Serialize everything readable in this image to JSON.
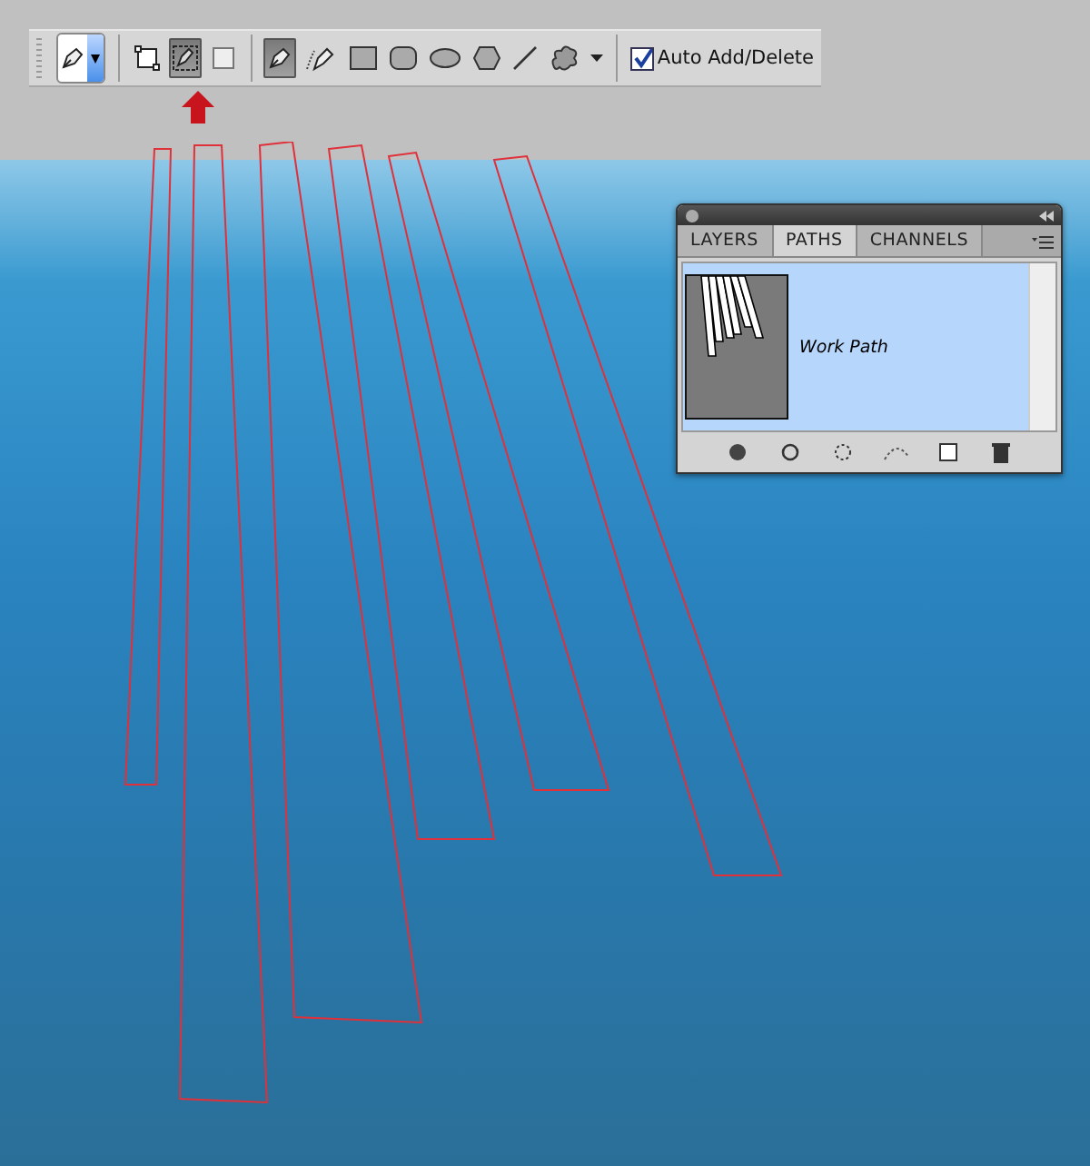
{
  "options_bar": {
    "modes": [
      {
        "kind": "shape-layers",
        "selected": false
      },
      {
        "kind": "paths",
        "selected": true
      },
      {
        "kind": "fill-pixels",
        "selected": false
      }
    ],
    "tools": [
      {
        "kind": "pen",
        "selected": true
      },
      {
        "kind": "freeform-pen",
        "selected": false
      },
      {
        "kind": "rectangle",
        "selected": false
      },
      {
        "kind": "rounded-rectangle",
        "selected": false
      },
      {
        "kind": "ellipse",
        "selected": false
      },
      {
        "kind": "polygon",
        "selected": false
      },
      {
        "kind": "line",
        "selected": false
      },
      {
        "kind": "custom-shape",
        "selected": false
      }
    ],
    "auto_add_delete": {
      "label": "Auto Add/Delete",
      "checked": true
    }
  },
  "paths_panel": {
    "tabs": [
      {
        "label": "LAYERS",
        "selected": false
      },
      {
        "label": "PATHS",
        "selected": true
      },
      {
        "label": "CHANNELS",
        "selected": false
      }
    ],
    "paths": [
      {
        "name": "Work Path",
        "selected": true
      }
    ]
  }
}
